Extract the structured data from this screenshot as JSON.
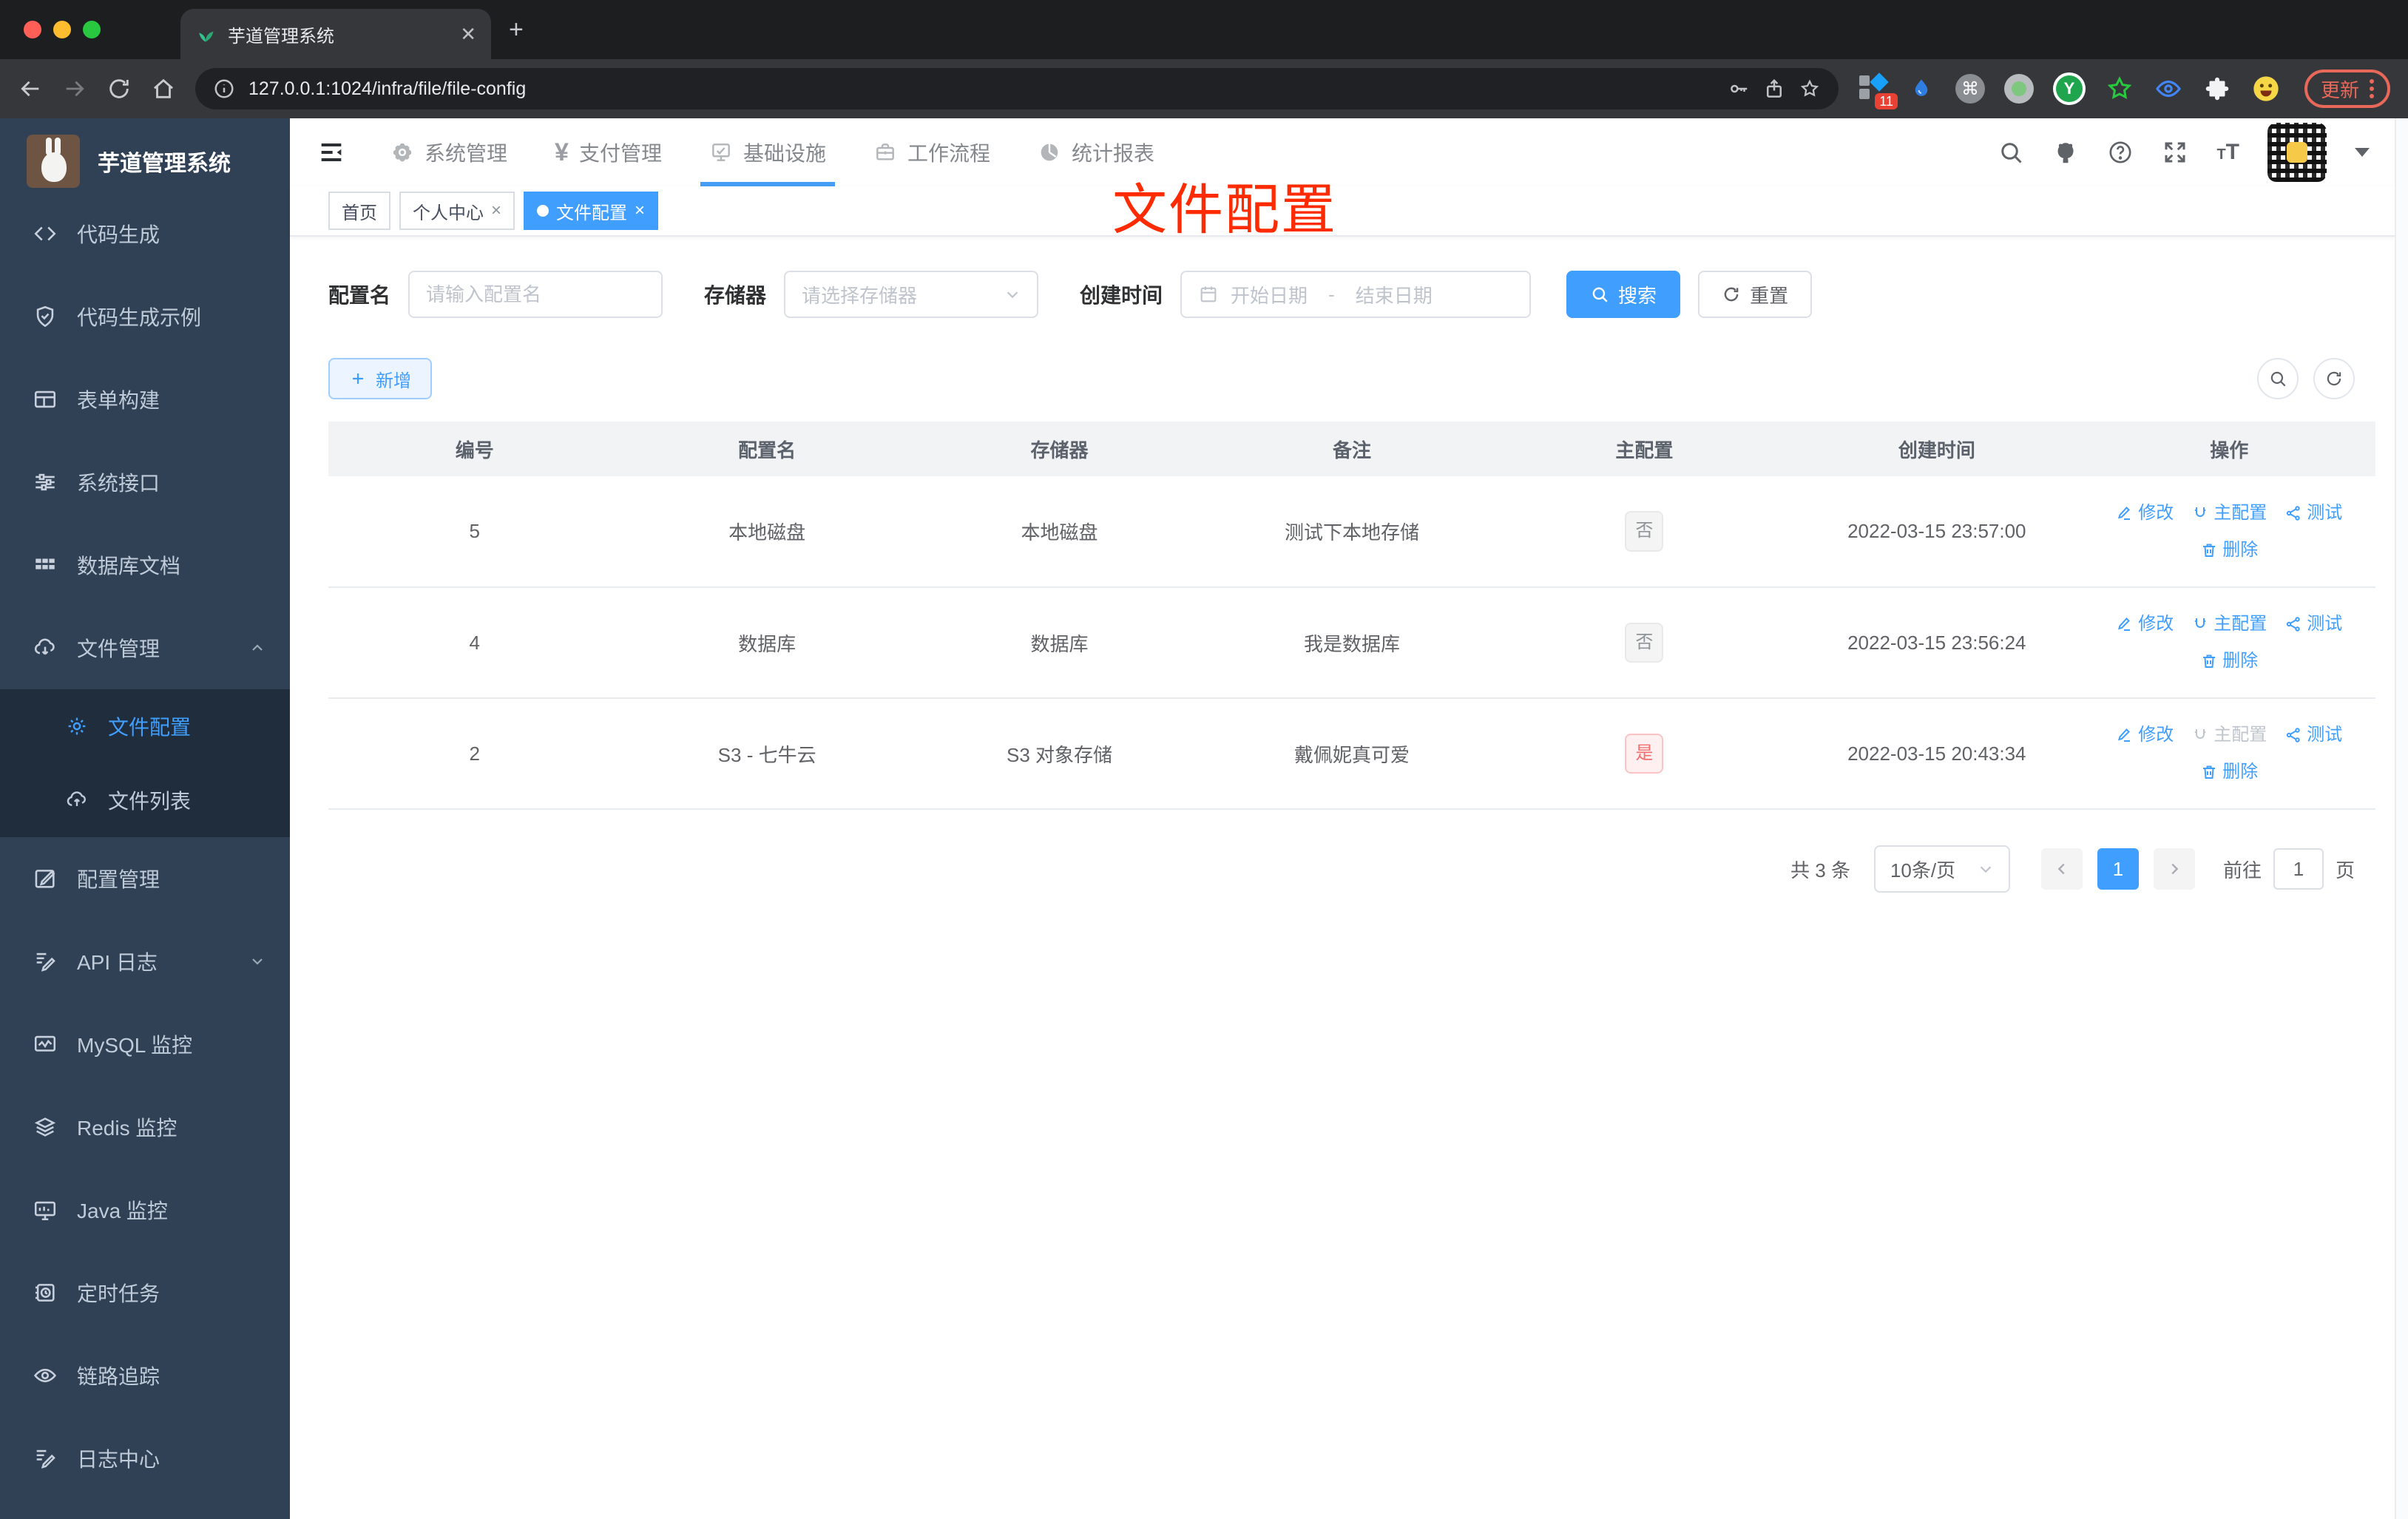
{
  "browser": {
    "tab_title": "芋道管理系统",
    "url": "127.0.0.1:1024/infra/file/file-config",
    "ext_badge": "11",
    "update_label": "更新"
  },
  "sidebar": {
    "title": "芋道管理系统",
    "items": [
      {
        "label": "代码生成"
      },
      {
        "label": "代码生成示例"
      },
      {
        "label": "表单构建"
      },
      {
        "label": "系统接口"
      },
      {
        "label": "数据库文档"
      },
      {
        "label": "文件管理"
      },
      {
        "label": "文件配置"
      },
      {
        "label": "文件列表"
      },
      {
        "label": "配置管理"
      },
      {
        "label": "API 日志"
      },
      {
        "label": "MySQL 监控"
      },
      {
        "label": "Redis 监控"
      },
      {
        "label": "Java 监控"
      },
      {
        "label": "定时任务"
      },
      {
        "label": "链路追踪"
      },
      {
        "label": "日志中心"
      }
    ]
  },
  "topnav": {
    "items": [
      {
        "label": "系统管理"
      },
      {
        "label": "支付管理"
      },
      {
        "label": "基础设施"
      },
      {
        "label": "工作流程"
      },
      {
        "label": "统计报表"
      }
    ]
  },
  "tags": [
    {
      "label": "首页"
    },
    {
      "label": "个人中心"
    },
    {
      "label": "文件配置"
    }
  ],
  "annotation": {
    "text": "文件配置",
    "color": "#fe2b00"
  },
  "filters": {
    "name_label": "配置名",
    "name_placeholder": "请输入配置名",
    "storage_label": "存储器",
    "storage_placeholder": "请选择存储器",
    "date_label": "创建时间",
    "date_start": "开始日期",
    "date_sep": "-",
    "date_end": "结束日期",
    "search_label": "搜索",
    "reset_label": "重置"
  },
  "toolbar": {
    "add_label": "新增"
  },
  "table": {
    "headers": [
      "编号",
      "配置名",
      "存储器",
      "备注",
      "主配置",
      "创建时间",
      "操作"
    ],
    "actions": {
      "edit": "修改",
      "master": "主配置",
      "test": "测试",
      "delete": "删除"
    },
    "rows": [
      {
        "id": "5",
        "name": "本地磁盘",
        "storage": "本地磁盘",
        "remark": "测试下本地存储",
        "master": "否",
        "created": "2022-03-15 23:57:00"
      },
      {
        "id": "4",
        "name": "数据库",
        "storage": "数据库",
        "remark": "我是数据库",
        "master": "否",
        "created": "2022-03-15 23:56:24"
      },
      {
        "id": "2",
        "name": "S3 - 七牛云",
        "storage": "S3 对象存储",
        "remark": "戴佩妮真可爱",
        "master": "是",
        "created": "2022-03-15 20:43:34"
      }
    ]
  },
  "pagination": {
    "total": "共 3 条",
    "page_size": "10条/页",
    "current_page": "1",
    "goto_label": "前往",
    "goto_value": "1",
    "page_suffix": "页"
  },
  "colors": {
    "accent": "#409eff",
    "sidebar_bg": "#304156",
    "submenu_bg": "#1f2d3d",
    "danger": "#f56c6c",
    "annotation": "#fe2b00"
  }
}
